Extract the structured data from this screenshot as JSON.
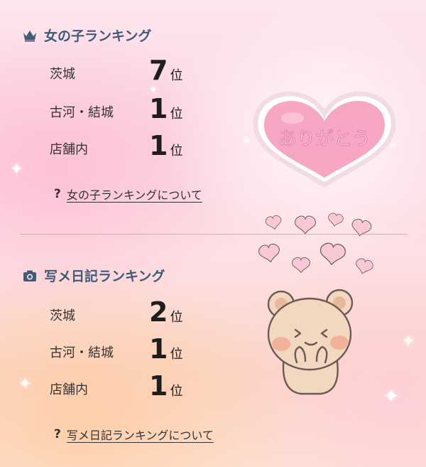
{
  "girls_ranking": {
    "title": "女の子ランキング",
    "icon": "crown-icon",
    "rows": [
      {
        "area": "茨城",
        "rank": "7",
        "suffix": "位"
      },
      {
        "area": "古河・結城",
        "rank": "1",
        "suffix": "位"
      },
      {
        "area": "店舗内",
        "rank": "1",
        "suffix": "位"
      }
    ],
    "about_q": "?",
    "about_link": "女の子ランキングについて"
  },
  "diary_ranking": {
    "title": "写メ日記ランキング",
    "icon": "camera-icon",
    "rows": [
      {
        "area": "茨城",
        "rank": "2",
        "suffix": "位"
      },
      {
        "area": "古河・結城",
        "rank": "1",
        "suffix": "位"
      },
      {
        "area": "店舗内",
        "rank": "1",
        "suffix": "位"
      }
    ],
    "about_q": "?",
    "about_link": "写メ日記ランキングについて"
  },
  "decoration": {
    "heart_text": "ありがとう",
    "title_color": "#3e5c76",
    "heart_color": "#f7a6c4"
  }
}
